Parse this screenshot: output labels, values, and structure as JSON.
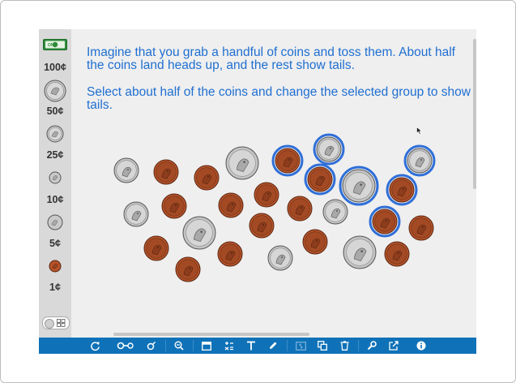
{
  "sidebar": {
    "items": [
      {
        "name": "dollar-bill",
        "label": "100¢"
      },
      {
        "name": "half-dollar",
        "label": "50¢"
      },
      {
        "name": "quarter",
        "label": "25¢"
      },
      {
        "name": "dime",
        "label": "10¢"
      },
      {
        "name": "nickel",
        "label": "5¢"
      },
      {
        "name": "penny",
        "label": "1¢"
      }
    ],
    "dollar_bill_text": "ONE"
  },
  "prompt": {
    "line1": "Imagine that you grab a handful of coins and toss them. About half the coins land heads up, and the rest show tails.",
    "line2": "Select about half of the coins and change the selected group to show tails."
  },
  "coins": [
    {
      "kind": "quarter",
      "selected": false
    },
    {
      "kind": "penny",
      "selected": false
    },
    {
      "kind": "penny",
      "selected": false
    },
    {
      "kind": "half",
      "selected": false
    },
    {
      "kind": "penny",
      "selected": true
    },
    {
      "kind": "quarter",
      "selected": true
    },
    {
      "kind": "quarter",
      "selected": true
    },
    {
      "kind": "penny",
      "selected": true
    },
    {
      "kind": "half",
      "selected": true
    },
    {
      "kind": "penny",
      "selected": true
    },
    {
      "kind": "quarter",
      "selected": false
    },
    {
      "kind": "penny",
      "selected": false
    },
    {
      "kind": "half",
      "selected": false
    },
    {
      "kind": "penny",
      "selected": false
    },
    {
      "kind": "penny",
      "selected": false
    },
    {
      "kind": "penny",
      "selected": false
    },
    {
      "kind": "quarter",
      "selected": false
    },
    {
      "kind": "penny",
      "selected": true
    },
    {
      "kind": "penny",
      "selected": false
    },
    {
      "kind": "penny",
      "selected": false
    },
    {
      "kind": "penny",
      "selected": false
    },
    {
      "kind": "penny",
      "selected": false
    },
    {
      "kind": "quarter",
      "selected": false
    },
    {
      "kind": "penny",
      "selected": false
    },
    {
      "kind": "half",
      "selected": false
    },
    {
      "kind": "penny",
      "selected": false
    },
    {
      "kind": "penny",
      "selected": false
    }
  ],
  "colors": {
    "toolbar": "#0f72b8",
    "prompt_text": "#1f6fd1",
    "selection_ring": "#2f6fd8",
    "penny": "#b4532a",
    "silver": "#c4c4c4",
    "background": "#efefef"
  },
  "toolbar": {
    "icons": [
      "refresh-icon",
      "link-icon",
      "gender-icon",
      "zoom-out-icon",
      "tables-icon",
      "calculator-icon",
      "text-icon",
      "pen-icon",
      "flip-icon",
      "clone-icon",
      "trash-icon",
      "wrench-icon",
      "share-icon",
      "info-icon"
    ]
  }
}
